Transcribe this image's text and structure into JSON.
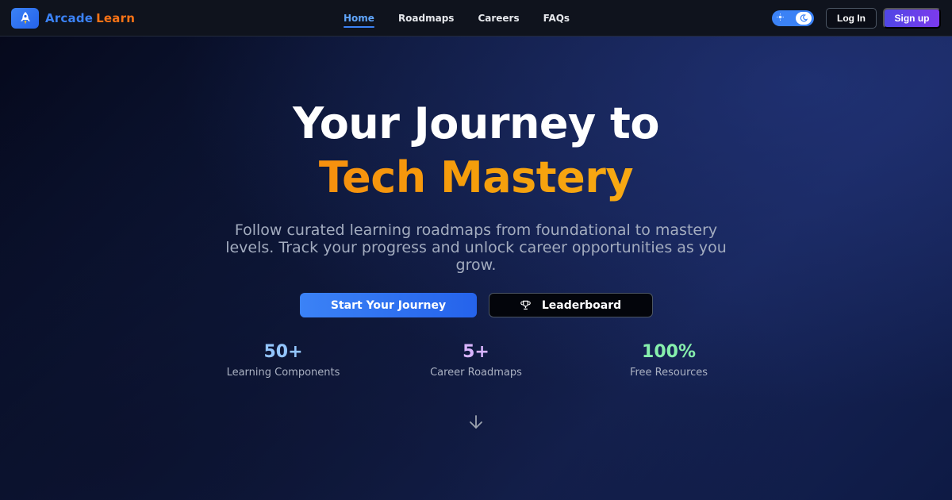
{
  "brand": {
    "name_part1": "Arcade",
    "name_part2": "Learn"
  },
  "nav": {
    "links": [
      {
        "label": "Home",
        "active": true
      },
      {
        "label": "Roadmaps",
        "active": false
      },
      {
        "label": "Careers",
        "active": false
      },
      {
        "label": "FAQs",
        "active": false
      }
    ],
    "theme_toggle": {
      "left_icon": "sun-icon",
      "right_icon": "moon-icon"
    },
    "login_label": "Log In",
    "signup_label": "Sign up"
  },
  "hero": {
    "title_line1": "Your Journey to",
    "title_line2": "Tech Mastery",
    "subtitle": "Follow curated learning roadmaps from foundational to mastery levels. Track your progress and unlock career opportunities as you grow.",
    "primary_cta": "Start Your Journey",
    "secondary_cta": "Leaderboard",
    "secondary_cta_icon": "trophy-icon"
  },
  "stats": [
    {
      "value": "50+",
      "label": "Learning Components",
      "color": "#93c5fd"
    },
    {
      "value": "5+",
      "label": "Career Roadmaps",
      "color": "#d8b4fe"
    },
    {
      "value": "100%",
      "label": "Free Resources",
      "color": "#86efac"
    }
  ],
  "scroll_icon": "arrow-down-icon",
  "colors": {
    "accent_blue": "#3b82f6",
    "accent_orange": "#f97316",
    "accent_purple": "#7c3aed"
  }
}
